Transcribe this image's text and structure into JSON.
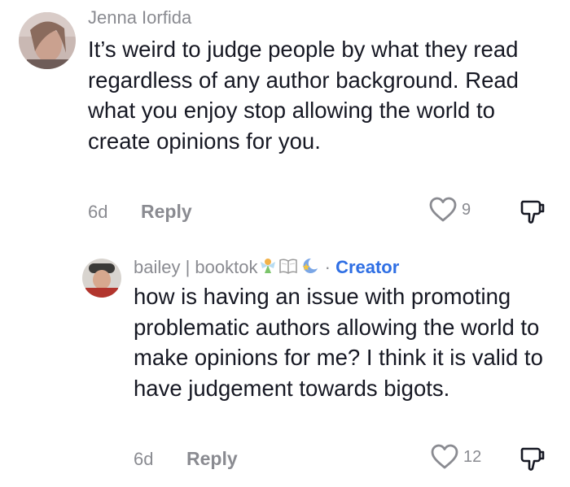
{
  "comments": [
    {
      "author": "Jenna Iorfida",
      "text": "It’s weird to judge people by what they read regardless of any author background. Read what you enjoy stop allowing the world to create opinions for you.",
      "age": "6d",
      "reply_label": "Reply",
      "likes": "9"
    },
    {
      "author": "bailey | booktok",
      "author_emoji": [
        "fairy",
        "open-book",
        "crescent-star"
      ],
      "separator": "·",
      "badge": "Creator",
      "text": "how is having an issue with promoting problematic authors allowing the world to make opinions for me? I think it is valid to have judgement towards bigots.",
      "age": "6d",
      "reply_label": "Reply",
      "likes": "12"
    }
  ],
  "colors": {
    "meta_gray": "#8a8b91",
    "text": "#161823",
    "creator_blue": "#2f6fe4"
  }
}
